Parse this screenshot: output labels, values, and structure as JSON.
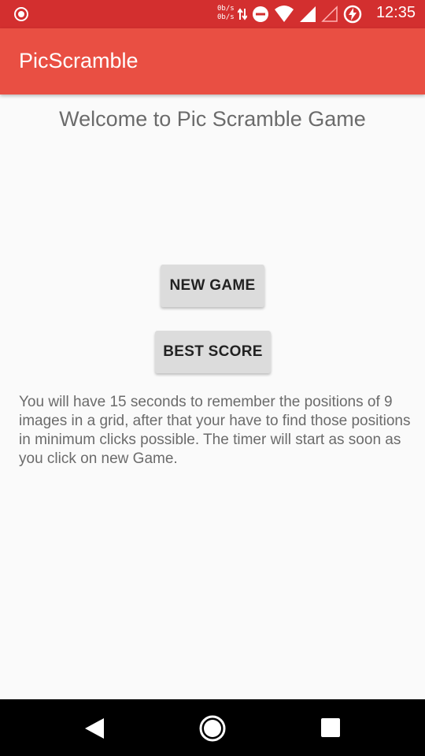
{
  "status_bar": {
    "net_up": "0b/s",
    "net_down": "0b/s",
    "time": "12:35",
    "icons": [
      "record-icon",
      "data-arrows-icon",
      "do-not-disturb-icon",
      "wifi-icon",
      "signal-icon",
      "signal-empty-icon",
      "battery-charging-icon"
    ]
  },
  "app_bar": {
    "title": "PicScramble"
  },
  "main": {
    "welcome": "Welcome to Pic Scramble Game",
    "new_game_label": "NEW GAME",
    "best_score_label": "BEST SCORE",
    "instructions": "You will have 15 seconds to remember the positions of 9 images in a grid, after that your have to find those positions in minimum clicks possible. The timer will start as soon as you click on new Game."
  },
  "nav_bar": {
    "icons": [
      "back-icon",
      "home-icon",
      "recents-icon"
    ]
  },
  "colors": {
    "status_bar": "#d32f2f",
    "app_bar": "#e94f43",
    "background": "#fafafa",
    "button": "#dcdcdc"
  }
}
